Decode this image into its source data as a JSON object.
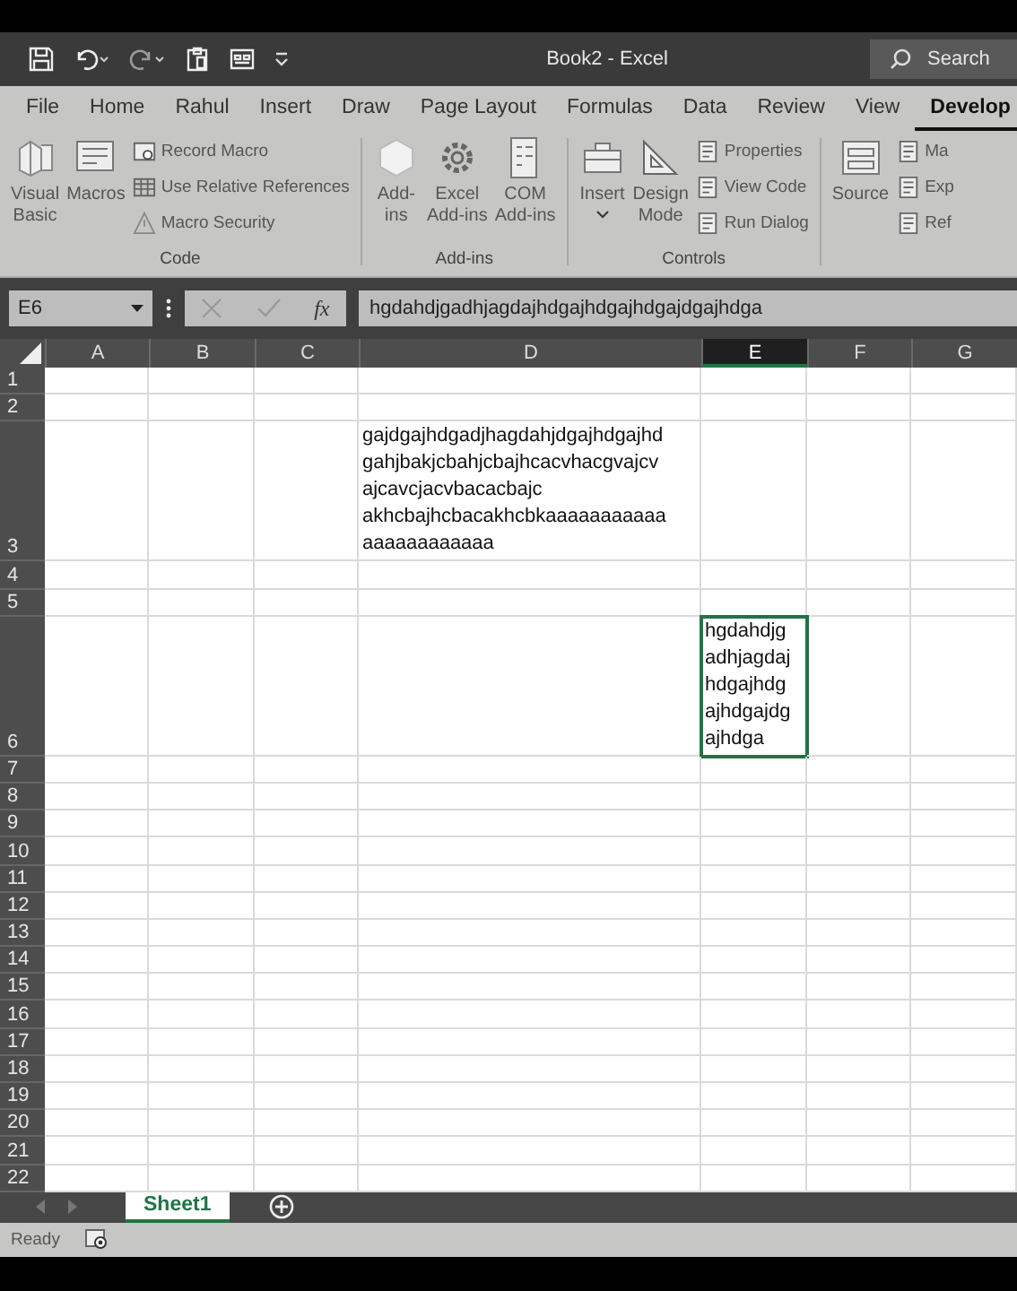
{
  "window": {
    "title": "Book2  -  Excel",
    "search": {
      "placeholder": "Search"
    }
  },
  "menu_tabs": [
    {
      "label": "File",
      "selected": false
    },
    {
      "label": "Home",
      "selected": false
    },
    {
      "label": "Rahul",
      "selected": false
    },
    {
      "label": "Insert",
      "selected": false
    },
    {
      "label": "Draw",
      "selected": false
    },
    {
      "label": "Page Layout",
      "selected": false
    },
    {
      "label": "Formulas",
      "selected": false
    },
    {
      "label": "Data",
      "selected": false
    },
    {
      "label": "Review",
      "selected": false
    },
    {
      "label": "View",
      "selected": false
    },
    {
      "label": "Develop",
      "selected": true
    }
  ],
  "ribbon_groups": [
    {
      "label": "Code",
      "large": [
        {
          "label": [
            "Visual",
            "Basic"
          ]
        },
        {
          "label": [
            "Macros"
          ]
        }
      ],
      "small": [
        {
          "label": "Record Macro"
        },
        {
          "label": "Use Relative References"
        },
        {
          "label": "Macro Security"
        }
      ]
    },
    {
      "label": "Add-ins",
      "large": [
        {
          "label": [
            "Add-",
            "ins"
          ]
        },
        {
          "label": [
            "Excel",
            "Add-ins"
          ]
        },
        {
          "label": [
            "COM",
            "Add-ins"
          ]
        }
      ]
    },
    {
      "label": "Controls",
      "large": [
        {
          "label": [
            "Insert"
          ]
        },
        {
          "label": [
            "Design",
            "Mode"
          ]
        }
      ],
      "small": [
        {
          "label": "Properties"
        },
        {
          "label": "View Code"
        },
        {
          "label": "Run Dialog"
        }
      ]
    },
    {
      "large": [
        {
          "label": [
            "Source"
          ]
        }
      ],
      "small": [
        {
          "label": "Ma"
        },
        {
          "label": "Exp"
        },
        {
          "label": "Ref"
        }
      ]
    }
  ],
  "formula_bar": {
    "name_box": "E6",
    "function_label": "fx",
    "value": "hgdahdjgadhjagdajhdgajhdgajhdgajdgajhdga"
  },
  "columns": [
    {
      "label": "A",
      "selected": false
    },
    {
      "label": "B",
      "selected": false
    },
    {
      "label": "C",
      "selected": false
    },
    {
      "label": "D",
      "selected": false
    },
    {
      "label": "E",
      "selected": true
    },
    {
      "label": "F",
      "selected": false
    },
    {
      "label": "G",
      "selected": false
    }
  ],
  "rows": [
    {
      "label": "1"
    },
    {
      "label": "2"
    },
    {
      "label": "3",
      "cells": [
        null,
        null,
        null,
        {
          "lines": [
            "gajdgajhdgadjhagdahjdgajhdgajhd",
            "gahjbakjcbahjcbajhcacvhacgvajcv",
            "ajcavcjacvbacacbajc",
            "akhcbajhcbacakhcbkaaaaaaaaaaa",
            "aaaaaaaaaaaa"
          ],
          "selected": false
        },
        null,
        null,
        null
      ]
    },
    {
      "label": "4"
    },
    {
      "label": "5"
    },
    {
      "label": "6",
      "cells": [
        null,
        null,
        null,
        null,
        {
          "lines": [
            "hgdahdjg",
            "adhjagdaj",
            "hdgajhdg",
            "ajhdgajdg",
            "ajhdga"
          ],
          "selected": true
        },
        null,
        null
      ]
    },
    {
      "label": "7"
    },
    {
      "label": "8"
    },
    {
      "label": "9"
    },
    {
      "label": "10"
    },
    {
      "label": "11"
    },
    {
      "label": "12"
    },
    {
      "label": "13"
    },
    {
      "label": "14"
    },
    {
      "label": "15"
    },
    {
      "label": "16"
    },
    {
      "label": "17"
    },
    {
      "label": "18"
    },
    {
      "label": "19"
    },
    {
      "label": "20"
    },
    {
      "label": "21"
    },
    {
      "label": "22"
    }
  ],
  "sheet_tabs": [
    {
      "label": "Sheet1",
      "selected": true
    }
  ],
  "status_bar": {
    "text": "Ready"
  }
}
